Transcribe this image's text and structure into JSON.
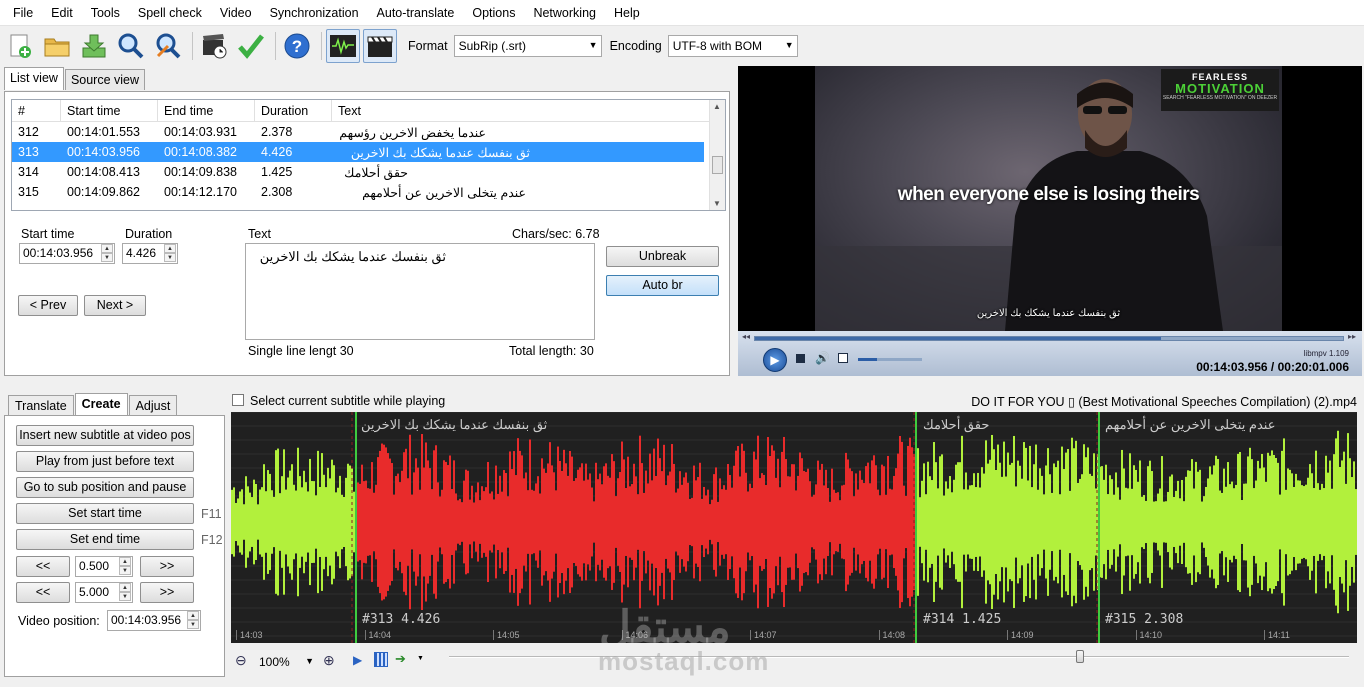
{
  "menu": [
    "File",
    "Edit",
    "Tools",
    "Spell check",
    "Video",
    "Synchronization",
    "Auto-translate",
    "Options",
    "Networking",
    "Help"
  ],
  "toolbar": {
    "format_label": "Format",
    "format_value": "SubRip (.srt)",
    "encoding_label": "Encoding",
    "encoding_value": "UTF-8 with BOM"
  },
  "view_tabs": [
    "List view",
    "Source view"
  ],
  "grid": {
    "headers": [
      "#",
      "Start time",
      "End time",
      "Duration",
      "Text"
    ],
    "rows": [
      {
        "num": "312",
        "start": "00:14:01.553",
        "end": "00:14:03.931",
        "duration": "2.378",
        "text": "عندما يخفض الاخرين رؤسهم"
      },
      {
        "num": "313",
        "start": "00:14:03.956",
        "end": "00:14:08.382",
        "duration": "4.426",
        "text": "ثق بنفسك عندما يشكك بك الاخرين",
        "selected": true
      },
      {
        "num": "314",
        "start": "00:14:08.413",
        "end": "00:14:09.838",
        "duration": "1.425",
        "text": "حقق أحلامك"
      },
      {
        "num": "315",
        "start": "00:14:09.862",
        "end": "00:14:12.170",
        "duration": "2.308",
        "text": "عندم يتخلى الاخرين عن أحلامهم"
      }
    ]
  },
  "editor": {
    "start_label": "Start time",
    "start_value": "00:14:03.956",
    "duration_label": "Duration",
    "duration_value": "4.426",
    "text_label": "Text",
    "chars_sec": "Chars/sec: 6.78",
    "text_value": "ثق بنفسك عندما يشكك بك الاخرين",
    "prev": "< Prev",
    "next": "Next >",
    "unbreak": "Unbreak",
    "auto_br": "Auto br",
    "single_line": "Single line lengt 30",
    "total_length": "Total length: 30"
  },
  "video": {
    "logo_line1": "FEARLESS",
    "logo_line2": "MOTIVATION",
    "logo_line3": "SEARCH \"FEARLESS MOTIVATION\" ON DEEZER",
    "caption": "when everyone else is losing theirs",
    "subtitle": "ثق بنفسك عندما يشكك بك الاخرين",
    "player_name": "libmpv 1.109",
    "time_display": "00:14:03.956 / 00:20:01.006"
  },
  "bottom_tabs": [
    "Translate",
    "Create",
    "Adjust"
  ],
  "create": {
    "insert": "Insert new subtitle at video pos",
    "play_before": "Play from just before text",
    "goto_pause": "Go to sub position and pause",
    "set_start": "Set start time",
    "set_start_key": "F11",
    "set_end": "Set end time",
    "set_end_key": "F12",
    "back": "<<",
    "fwd": ">>",
    "step1": "0.500",
    "step2": "5.000",
    "video_pos_label": "Video position:",
    "video_pos_value": "00:14:03.956"
  },
  "waveform": {
    "select_while_playing": "Select current subtitle while playing",
    "file_title": "DO IT FOR YOU ▯ (Best Motivational Speeches Compilation) (2).mp4",
    "seg_313_text": "ثق بنفسك عندما يشكك بك الاخرين",
    "seg_313_tag": "#313  4.426",
    "seg_314_text": "حقق أحلامك",
    "seg_314_tag": "#314  1.425",
    "seg_315_text": "عندم يتخلى الاخرين عن أحلامهم",
    "seg_315_tag": "#315  2.308",
    "prev_text": "",
    "ticks": [
      "14:03",
      "14:04",
      "14:05",
      "14:06",
      "14:07",
      "14:08",
      "14:09",
      "14:10",
      "14:11"
    ],
    "zoom": "100%",
    "watermark_ar": "مستقل",
    "watermark_en": "mostaql.com"
  },
  "colors": {
    "selected_row": "#3399ff",
    "wave_green": "#b2f03c",
    "wave_red": "#e82b2b",
    "wave_bg": "#202020"
  }
}
